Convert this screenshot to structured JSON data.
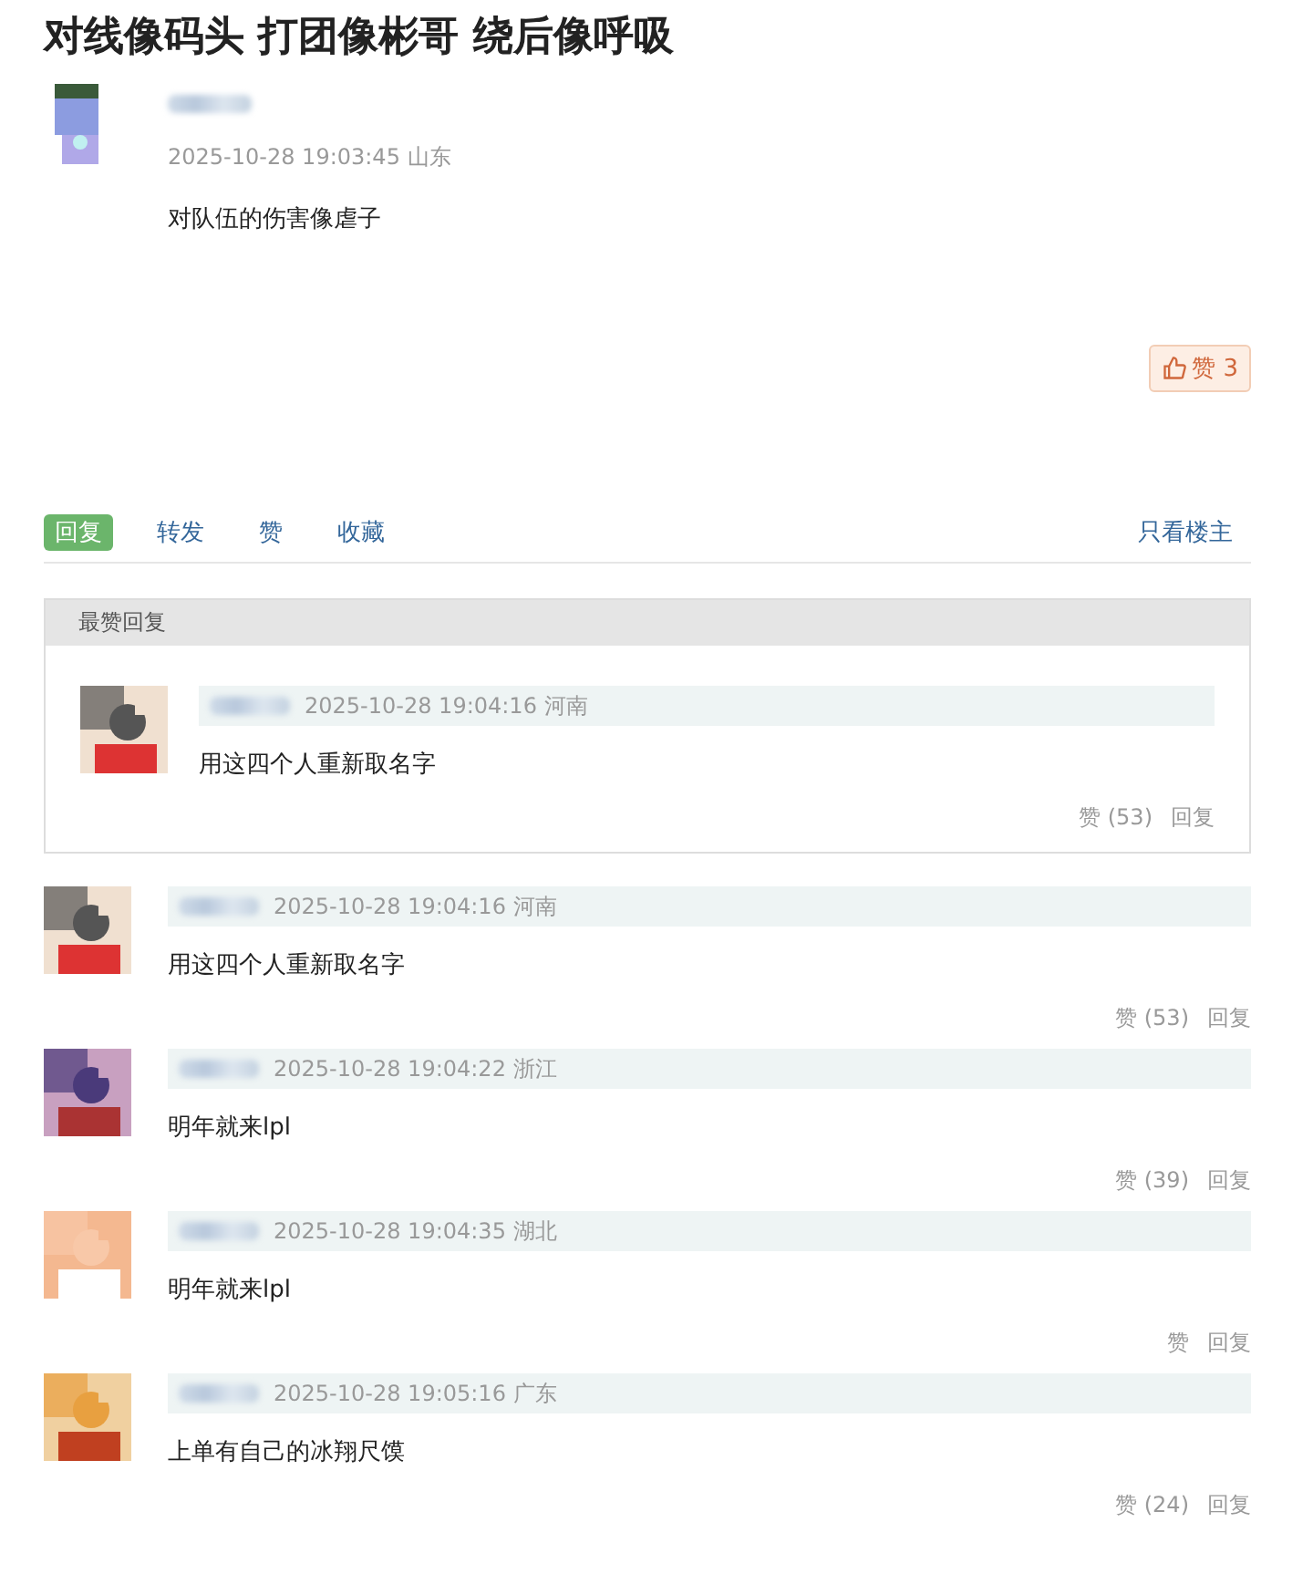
{
  "title": "对线像码头 打团像彬哥 绕后像呼吸",
  "post": {
    "timestamp": "2025-10-28 19:03:45 山东",
    "content": "对队伍的伤害像虐子",
    "like_button": {
      "label": "赞 3"
    }
  },
  "actions": [
    {
      "label": "回复",
      "selected": true
    },
    {
      "label": "转发",
      "selected": false
    },
    {
      "label": "赞",
      "selected": false
    },
    {
      "label": "收藏",
      "selected": false
    }
  ],
  "only_op": "只看楼主",
  "top_reply": {
    "heading": "最赞回复",
    "reply": {
      "timestamp": "2025-10-28 19:04:16 河南",
      "content": "用这四个人重新取名字",
      "like_label": "赞",
      "like_count": "(53)",
      "reply_label": "回复"
    }
  },
  "comments": [
    {
      "timestamp": "2025-10-28 19:04:16 河南",
      "content": "用这四个人重新取名字",
      "like_label": "赞",
      "like_count": "(53)",
      "reply_label": "回复"
    },
    {
      "timestamp": "2025-10-28 19:04:22 浙江",
      "content": "明年就来lpl",
      "like_label": "赞",
      "like_count": "(39)",
      "reply_label": "回复"
    },
    {
      "timestamp": "2025-10-28 19:04:35 湖北",
      "content": "明年就来lpl",
      "like_label": "赞",
      "reply_label": "回复"
    },
    {
      "timestamp": "2025-10-28 19:05:16 广东",
      "content": "上单有自己的冰翔尺馍",
      "like_label": "赞",
      "like_count": "(24)",
      "reply_label": "回复"
    }
  ]
}
